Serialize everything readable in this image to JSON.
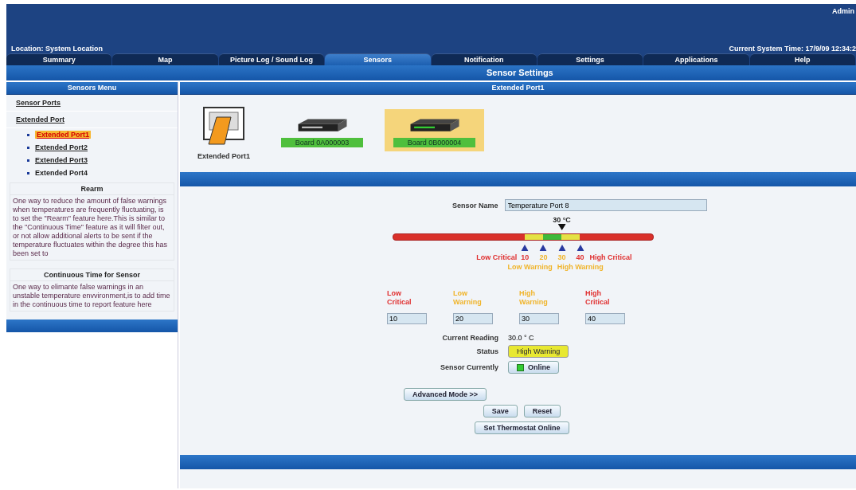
{
  "header": {
    "user": "Admin",
    "location": "Location: System Location",
    "time": "Current System Time: 17/9/09 12:34:2"
  },
  "tabs": [
    {
      "label": "Summary",
      "selected": false
    },
    {
      "label": "Map",
      "selected": false
    },
    {
      "label": "Picture Log / Sound Log",
      "selected": false
    },
    {
      "label": "Sensors",
      "selected": true
    },
    {
      "label": "Notification",
      "selected": false
    },
    {
      "label": "Settings",
      "selected": false
    },
    {
      "label": "Applications",
      "selected": false
    },
    {
      "label": "Help",
      "selected": false
    }
  ],
  "page_title": "Sensor Settings",
  "sidebar": {
    "title": "Sensors Menu",
    "items": [
      {
        "label": "Sensor Ports",
        "selected": false
      },
      {
        "label": "Extended Port",
        "selected": false,
        "children": [
          {
            "label": "Extended Port1",
            "selected": true,
            "underlined": true
          },
          {
            "label": "Extended Port2",
            "selected": false,
            "underlined": true
          },
          {
            "label": "Extended Port3",
            "selected": false,
            "underlined": true
          },
          {
            "label": "Extended Port4",
            "selected": false,
            "underlined": false
          }
        ]
      }
    ],
    "help": [
      {
        "title": "Rearm",
        "text": "One way to reduce the amount of false warnings when temperatures are frequently fluctuating, is to set the \"Rearm\" feature here.This is similar to the \"Continuous Time\" feature as it will filter out, or not allow additional alerts to be sent if the temperature fluctuates within the degree this has been set to"
      },
      {
        "title": "Continuous Time for Sensor",
        "text": "One way to elimante false warnings in an unstable temperature envvironment,is to add time in the continuous time to report feature here"
      }
    ]
  },
  "panel_title": "Extended Port1",
  "devices": [
    {
      "kind": "port",
      "label": "Extended Port1",
      "selected": false
    },
    {
      "kind": "board",
      "label": "Board 0A000003",
      "selected": false
    },
    {
      "kind": "board",
      "label": "Board 0B000004",
      "selected": true
    }
  ],
  "form": {
    "name_label": "Sensor Name",
    "name_value": "Temperature Port 8",
    "pointer_label": "30 °C",
    "scale": [
      {
        "kind": "critical",
        "value": "10",
        "caption": "Low Critical"
      },
      {
        "kind": "warning",
        "value": "20",
        "caption": "Low Warning"
      },
      {
        "kind": "warning",
        "value": "30",
        "caption": "High Warning"
      },
      {
        "kind": "critical",
        "value": "40",
        "caption": "High Critical"
      }
    ],
    "thresholds": [
      {
        "kind": "critical",
        "label": "Low Critical",
        "value": "10"
      },
      {
        "kind": "warning",
        "label": "Low Warning",
        "value": "20"
      },
      {
        "kind": "warning",
        "label": "High Warning",
        "value": "30"
      },
      {
        "kind": "critical",
        "label": "High Critical",
        "value": "40"
      }
    ],
    "reading_label": "Current Reading",
    "reading": "30.0 ° C",
    "status_label": "Status",
    "status": "High Warning",
    "online_label": "Sensor Currently",
    "online": "Online",
    "buttons": [
      "Advanced Mode >>",
      "Save",
      "Reset",
      "Set Thermostat Online"
    ]
  }
}
